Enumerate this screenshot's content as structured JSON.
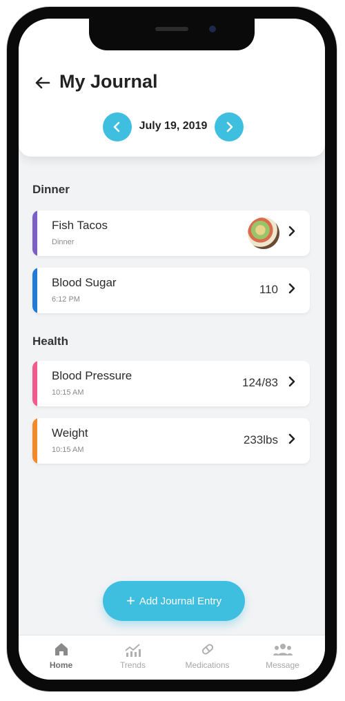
{
  "header": {
    "title": "My Journal",
    "date": "July 19, 2019",
    "prev_icon": "chevron-left-icon",
    "next_icon": "chevron-right-icon"
  },
  "sections": [
    {
      "title": "Dinner",
      "entries": [
        {
          "name": "Fish Tacos",
          "sub": "Dinner",
          "value": "",
          "accent": "#7b5fc7",
          "has_thumb": true
        },
        {
          "name": "Blood Sugar",
          "sub": "6:12 PM",
          "value": "110",
          "accent": "#1f7bd6",
          "has_thumb": false
        }
      ]
    },
    {
      "title": "Health",
      "entries": [
        {
          "name": "Blood Pressure",
          "sub": "10:15 AM",
          "value": "124/83",
          "accent": "#ef5b8c",
          "has_thumb": false
        },
        {
          "name": "Weight",
          "sub": "10:15 AM",
          "value": "233lbs",
          "accent": "#f08a2c",
          "has_thumb": false
        }
      ]
    }
  ],
  "fab": {
    "label": "Add Journal Entry",
    "icon": "plus-icon"
  },
  "tabs": [
    {
      "label": "Home",
      "icon": "home-icon",
      "active": true
    },
    {
      "label": "Trends",
      "icon": "trends-icon",
      "active": false
    },
    {
      "label": "Medications",
      "icon": "pill-icon",
      "active": false
    },
    {
      "label": "Message",
      "icon": "group-icon",
      "active": false
    }
  ],
  "colors": {
    "accent": "#3fbfe0",
    "background": "#f2f3f5"
  }
}
